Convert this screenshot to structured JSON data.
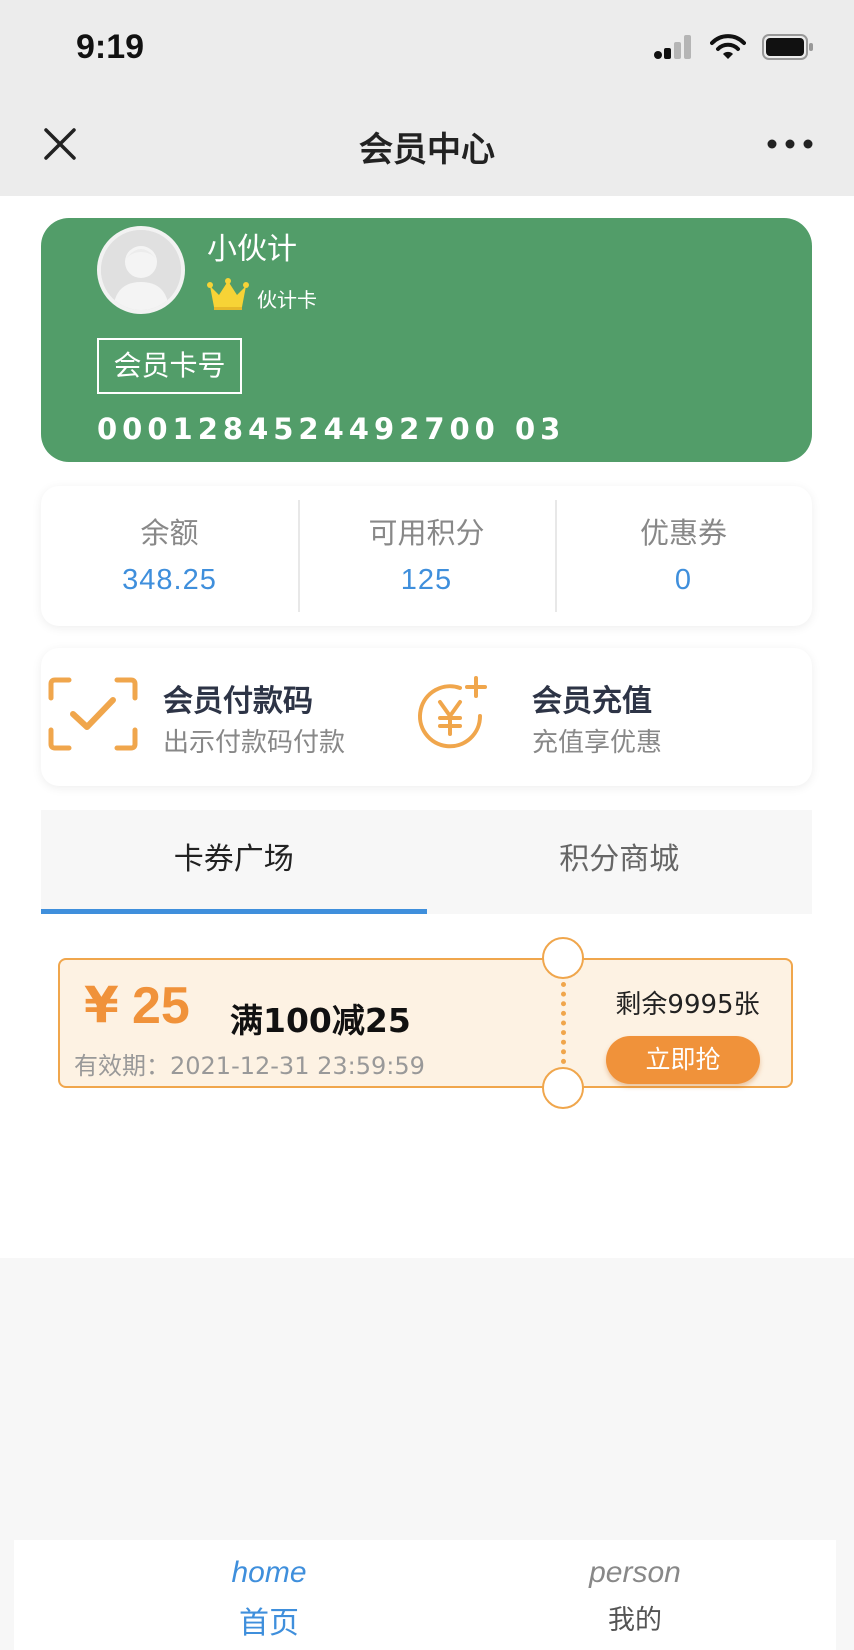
{
  "status_bar": {
    "time": "9:19"
  },
  "nav": {
    "title": "会员中心"
  },
  "member_card": {
    "name": "小伙计",
    "level": "伙计卡",
    "card_no_label": "会员卡号",
    "card_number": "0001284524492700 03"
  },
  "stats": [
    {
      "label": "余额",
      "value": "348.25"
    },
    {
      "label": "可用积分",
      "value": "125"
    },
    {
      "label": "优惠券",
      "value": "0"
    }
  ],
  "actions": [
    {
      "title": "会员付款码",
      "subtitle": "出示付款码付款",
      "icon": "scan-check-icon"
    },
    {
      "title": "会员充值",
      "subtitle": "充值享优惠",
      "icon": "yen-plus-icon"
    }
  ],
  "tabs": [
    {
      "label": "卡券广场",
      "active": true
    },
    {
      "label": "积分商城",
      "active": false
    }
  ],
  "coupon": {
    "currency": "¥",
    "amount": "25",
    "title": "满100减25",
    "validity": "有效期：2021-12-31 23:59:59",
    "remaining": "剩余9995张",
    "button": "立即抢"
  },
  "bottom_nav": [
    {
      "en": "home",
      "cn": "首页",
      "active": true
    },
    {
      "en": "person",
      "cn": "我的",
      "active": false
    }
  ],
  "colors": {
    "card_green": "#529d69",
    "accent_blue": "#3f8fdc",
    "coupon_orange": "#f0923a",
    "icon_orange": "#f0a64c"
  }
}
